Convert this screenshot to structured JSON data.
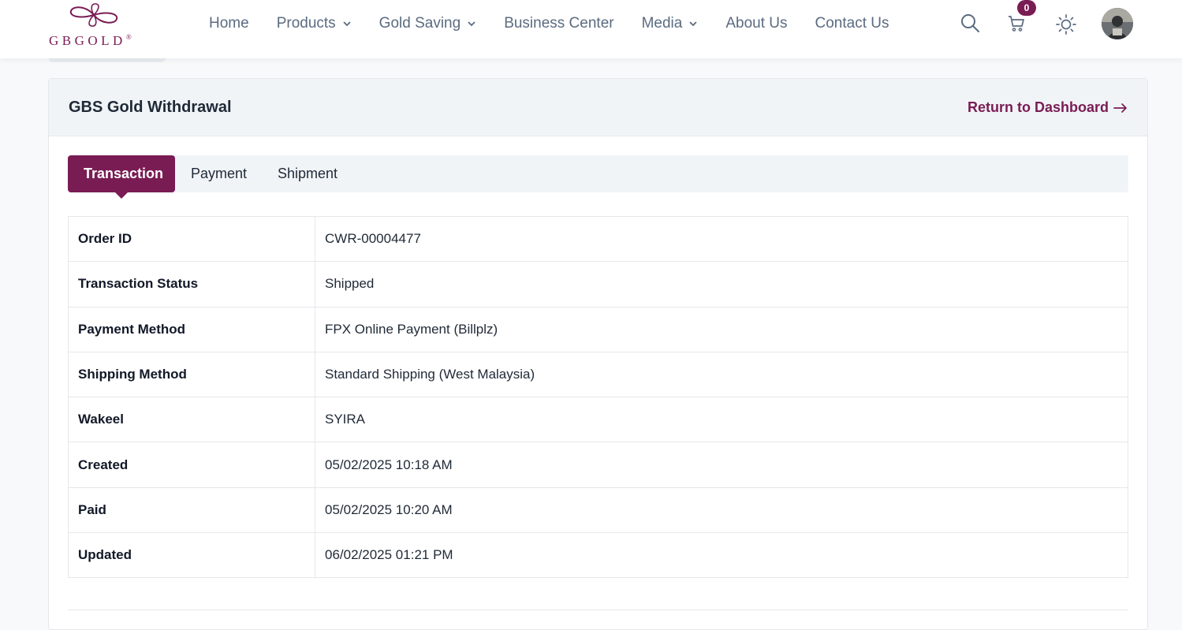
{
  "brand": {
    "name": "GBGOLD",
    "mark": "®",
    "color": "#7a1c54"
  },
  "nav": {
    "items": [
      {
        "label": "Home"
      },
      {
        "label": "Products"
      },
      {
        "label": "Gold Saving"
      },
      {
        "label": "Business Center"
      },
      {
        "label": "Media"
      },
      {
        "label": "About Us"
      },
      {
        "label": "Contact Us"
      }
    ]
  },
  "header_icons": {
    "search": "search-icon",
    "cart": "cart-icon",
    "cart_count": "0",
    "theme": "sun-icon",
    "avatar": "user-avatar"
  },
  "page": {
    "title": "GBS Gold Withdrawal",
    "return_label": "Return to Dashboard"
  },
  "tabs": [
    {
      "label": "Transaction",
      "active": true
    },
    {
      "label": "Payment",
      "active": false
    },
    {
      "label": "Shipment",
      "active": false
    }
  ],
  "details": [
    {
      "label": "Order ID",
      "value": "CWR-00004477"
    },
    {
      "label": "Transaction Status",
      "value": "Shipped"
    },
    {
      "label": "Payment Method",
      "value": "FPX Online Payment (Billplz)"
    },
    {
      "label": "Shipping Method",
      "value": "Standard Shipping (West Malaysia)"
    },
    {
      "label": "Wakeel",
      "value": "SYIRA"
    },
    {
      "label": "Created",
      "value": "05/02/2025 10:18 AM"
    },
    {
      "label": "Paid",
      "value": "05/02/2025 10:20 AM"
    },
    {
      "label": "Updated",
      "value": "06/02/2025 01:21 PM"
    }
  ],
  "colors": {
    "accent": "#7a1c54",
    "status_shipped": "#21c997",
    "nav_text": "#5b6b80"
  }
}
